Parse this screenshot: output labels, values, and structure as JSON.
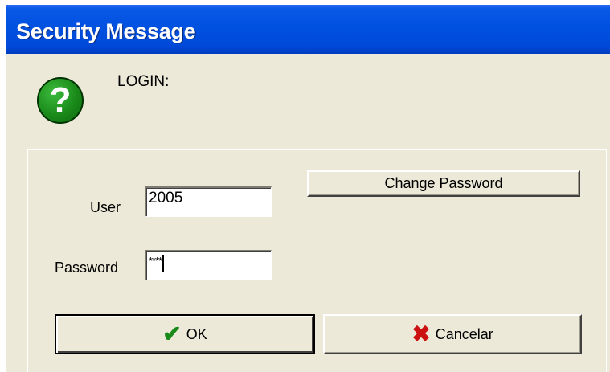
{
  "window": {
    "title": "Security Message"
  },
  "message": {
    "label": "LOGIN:",
    "icon": "question-icon"
  },
  "form": {
    "user_label": "User",
    "user_value": "2005",
    "password_label": "Password",
    "password_value": "****",
    "change_password_label": "Change Password"
  },
  "buttons": {
    "ok_label": "OK",
    "cancel_label": "Cancelar"
  },
  "colors": {
    "titlebar": "#0050e0",
    "dialog_bg": "#ece9d8",
    "question_icon": "#1a8a1a",
    "cancel_x": "#cc1111"
  }
}
